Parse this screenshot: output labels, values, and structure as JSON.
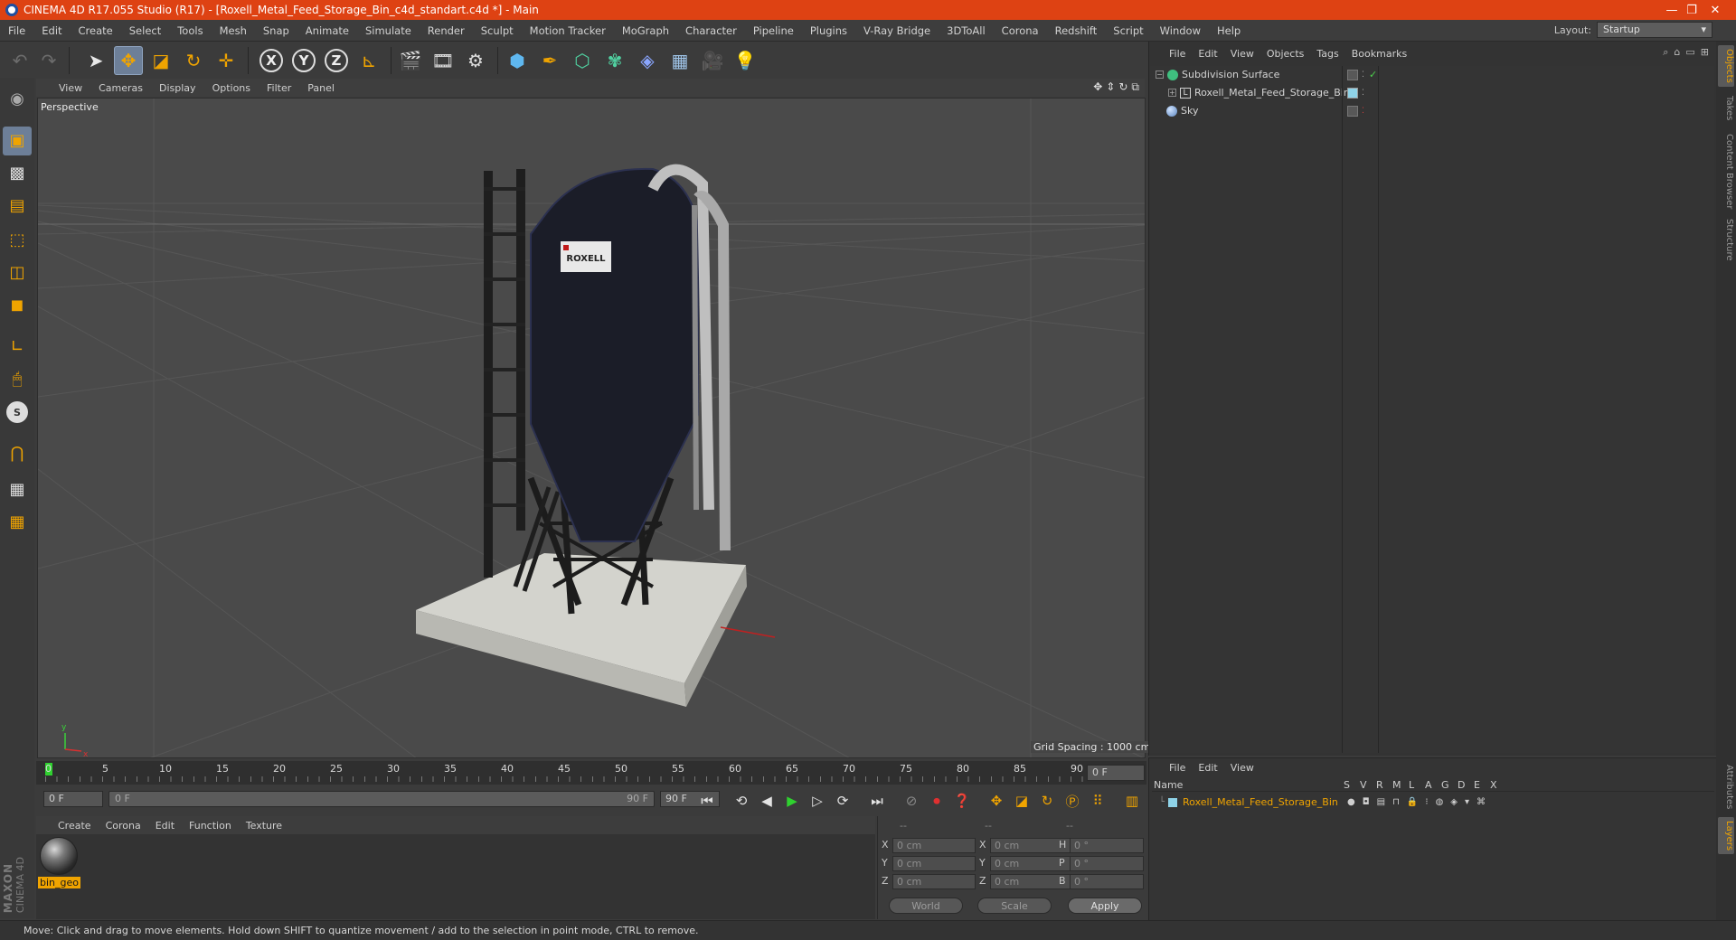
{
  "window": {
    "title": "CINEMA 4D R17.055 Studio (R17) - [Roxell_Metal_Feed_Storage_Bin_c4d_standart.c4d *] - Main",
    "minimize": "—",
    "restore": "❐",
    "close": "✕"
  },
  "menubar": {
    "items": [
      "File",
      "Edit",
      "Create",
      "Select",
      "Tools",
      "Mesh",
      "Snap",
      "Animate",
      "Simulate",
      "Render",
      "Sculpt",
      "Motion Tracker",
      "MoGraph",
      "Character",
      "Pipeline",
      "Plugins",
      "V-Ray Bridge",
      "3DToAll",
      "Corona",
      "Redshift",
      "Script",
      "Window",
      "Help"
    ],
    "layout_label": "Layout:",
    "layout_value": "Startup"
  },
  "toolbar": {
    "axis_x": "X",
    "axis_y": "Y",
    "axis_z": "Z"
  },
  "viewport": {
    "menu": [
      "View",
      "Cameras",
      "Display",
      "Options",
      "Filter",
      "Panel"
    ],
    "name": "Perspective",
    "grid_spacing": "Grid Spacing : 1000 cm",
    "axis_y": "y",
    "axis_x": "x",
    "logo_text": "ROXELL"
  },
  "timeline": {
    "ticks": [
      "0",
      "5",
      "10",
      "15",
      "20",
      "25",
      "30",
      "35",
      "40",
      "45",
      "50",
      "55",
      "60",
      "65",
      "70",
      "75",
      "80",
      "85",
      "90"
    ],
    "current_frame": "0 F",
    "start_field": "0 F",
    "range_start": "0 F",
    "range_end": "90 F",
    "end_field": "90 F"
  },
  "material_manager": {
    "menu": [
      "Create",
      "Corona",
      "Edit",
      "Function",
      "Texture"
    ],
    "material_name": "bin_geo"
  },
  "coordinates": {
    "header_1": "--",
    "header_2": "--",
    "header_3": "--",
    "rows": [
      {
        "l1": "X",
        "v1": "0 cm",
        "l2": "X",
        "v2": "0 cm",
        "l3": "H",
        "v3": "0 °"
      },
      {
        "l1": "Y",
        "v1": "0 cm",
        "l2": "Y",
        "v2": "0 cm",
        "l3": "P",
        "v3": "0 °"
      },
      {
        "l1": "Z",
        "v1": "0 cm",
        "l2": "Z",
        "v2": "0 cm",
        "l3": "B",
        "v3": "0 °"
      }
    ],
    "mode_world": "World",
    "mode_scale": "Scale",
    "apply": "Apply"
  },
  "object_manager": {
    "menu": [
      "File",
      "Edit",
      "View",
      "Objects",
      "Tags",
      "Bookmarks"
    ],
    "objects": [
      {
        "name": "Subdivision Surface"
      },
      {
        "name": "Roxell_Metal_Feed_Storage_Bin"
      },
      {
        "name": "Sky"
      }
    ]
  },
  "layer_manager": {
    "menu": [
      "File",
      "Edit",
      "View"
    ],
    "header_name": "Name",
    "header_cols": [
      "S",
      "V",
      "R",
      "M",
      "L",
      "A",
      "G",
      "D",
      "E",
      "X"
    ],
    "layers": [
      {
        "name": "Roxell_Metal_Feed_Storage_Bin"
      }
    ]
  },
  "side_tabs": [
    "Objects",
    "Takes",
    "Content Browser",
    "Structure"
  ],
  "side_tabs_bottom": [
    "Attributes",
    "Layers"
  ],
  "status": {
    "text": "Move: Click and drag to move elements. Hold down SHIFT to quantize movement / add to the selection in point mode, CTRL to remove."
  },
  "branding": {
    "maxon": "MAXON",
    "cinema": "CINEMA 4D"
  },
  "colors": {
    "title_bar": "#de4213",
    "accent": "#f0a400",
    "selected_tool": "#6d7f98",
    "viewport_bg": "#4a4a4a"
  }
}
